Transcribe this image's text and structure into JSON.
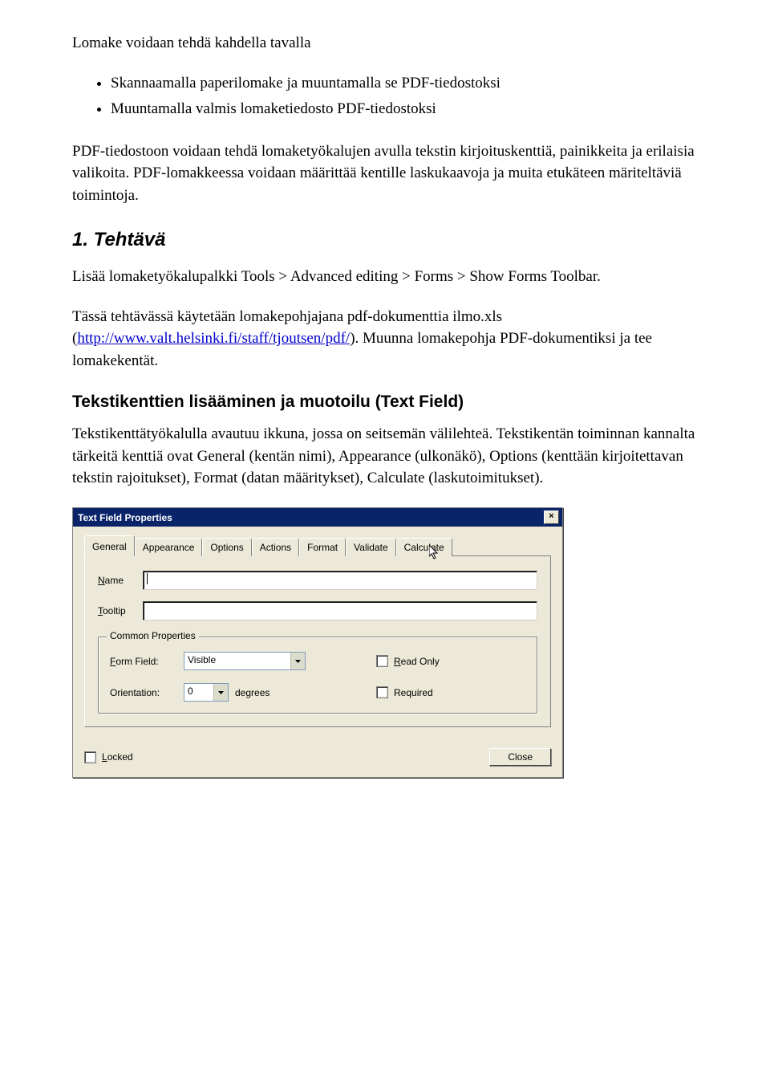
{
  "intro_heading": "Lomake voidaan tehdä kahdella tavalla",
  "bullet_items": [
    "Skannaamalla paperilomake ja muuntamalla se PDF-tiedostoksi",
    "Muuntamalla valmis lomaketiedosto PDF-tiedostoksi"
  ],
  "intro_para": "PDF-tiedostoon voidaan tehdä lomaketyökalujen avulla tekstin kirjoituskenttiä, painikkeita ja erilaisia valikoita. PDF-lomakkeessa voidaan määrittää kentille laskukaavoja ja muita etukäteen märiteltäviä toimintoja.",
  "section1_title": "1. Tehtävä",
  "section1_para1": "Lisää lomaketyökalupalkki Tools > Advanced editing > Forms > Show Forms Toolbar.",
  "section1_para2_pre": "Tässä tehtävässä käytetään lomakepohjajana pdf-dokumenttia ilmo.xls (",
  "section1_link_text": "http://www.valt.helsinki.fi/staff/tjoutsen/pdf/",
  "section1_para2_post": "). Muunna lomakepohja PDF-dokumentiksi ja tee lomakekentät.",
  "section2_title": "Tekstikenttien lisääminen ja muotoilu (Text Field)",
  "section2_para": "Tekstikenttätyökalulla avautuu ikkuna, jossa on seitsemän välilehteä. Tekstikentän toiminnan kannalta tärkeitä kenttiä ovat General (kentän nimi), Appearance (ulkonäkö), Options (kenttään kirjoitettavan tekstin rajoitukset), Format (datan määritykset), Calculate (laskutoimitukset).",
  "dialog": {
    "title": "Text Field Properties",
    "close_symbol": "×",
    "tabs": [
      "General",
      "Appearance",
      "Options",
      "Actions",
      "Format",
      "Validate",
      "Calculate"
    ],
    "active_tab_index": 0,
    "name_label_pre": "N",
    "name_label_post": "ame",
    "name_value": "",
    "tooltip_label_pre": "T",
    "tooltip_label_post": "ooltip",
    "tooltip_value": "",
    "group_legend": "Common Properties",
    "formfield_label_pre": "F",
    "formfield_label_post": "orm Field:",
    "formfield_value": "Visible",
    "orientation_label": "Orientation:",
    "orientation_value": "0",
    "degrees_label": "degrees",
    "readonly_label_pre": "R",
    "readonly_label_post": "ead Only",
    "required_label": "Required",
    "locked_label_pre": "L",
    "locked_label_post": "ocked",
    "close_btn": "Close"
  }
}
